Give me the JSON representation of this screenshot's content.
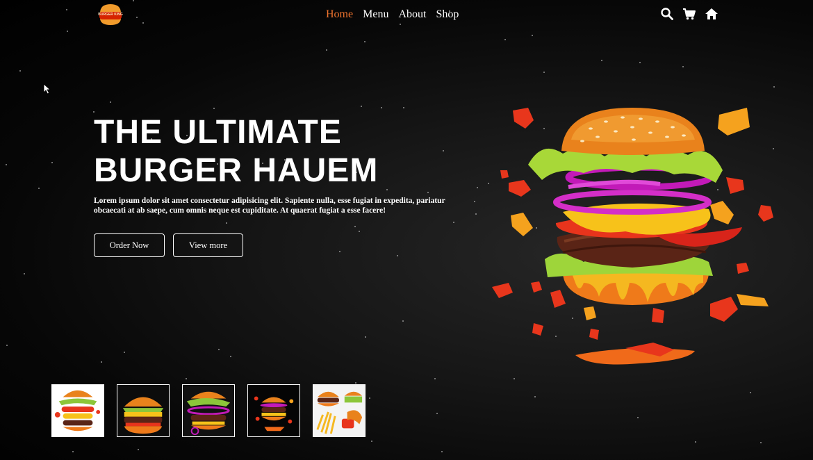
{
  "brand": {
    "logo_text": "BURGER KING"
  },
  "nav": {
    "items": [
      {
        "label": "Home",
        "active": true
      },
      {
        "label": "Menu",
        "active": false
      },
      {
        "label": "About",
        "active": false
      },
      {
        "label": "Shop",
        "active": false
      }
    ],
    "active_color": "#f0742e"
  },
  "icons": [
    "search-icon",
    "cart-icon",
    "home-icon"
  ],
  "hero": {
    "title": "THE ULTIMATE\nBURGER HAUEM",
    "description": "Lorem ipsum dolor sit amet consectetur adipisicing elit. Sapiente nulla, esse fugiat in expedita, pariatur obcaecati at ab saepe, cum omnis neque est cupiditate. At quaerat fugiat a esse facere!",
    "order_label": "Order Now",
    "view_label": "View more"
  },
  "thumbnails": [
    "exploded-burger",
    "classic-burger",
    "flying-burger",
    "dark-burger",
    "burger-with-fries"
  ]
}
